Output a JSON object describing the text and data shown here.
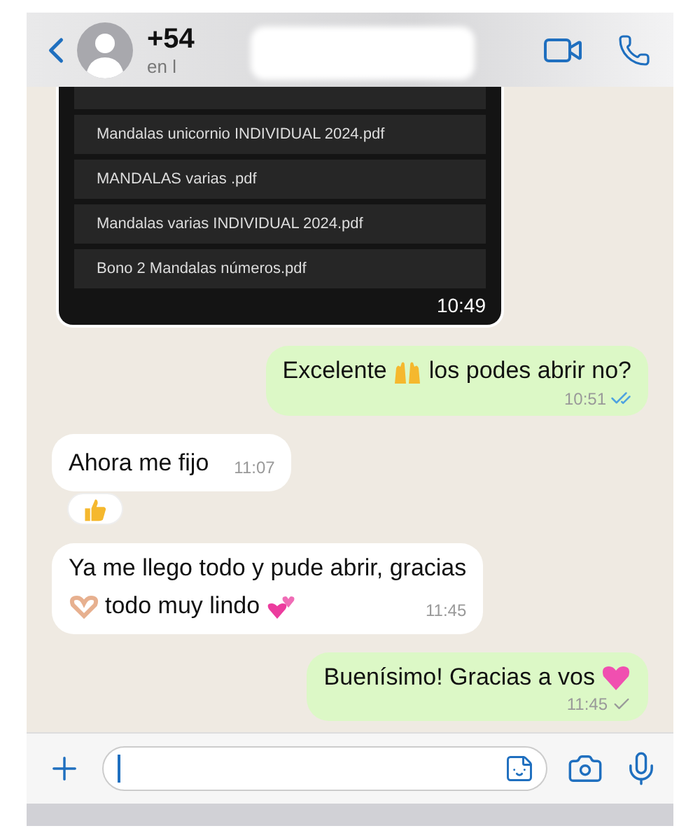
{
  "header": {
    "name": "+54",
    "status": "en l"
  },
  "files": {
    "items": [
      "Mandalas unicornio INDIVIDUAL 2024.pdf",
      "MANDALAS varias .pdf",
      "Mandalas varias INDIVIDUAL 2024.pdf",
      "Bono 2 Mandalas números.pdf"
    ],
    "time": "10:49"
  },
  "messages": [
    {
      "kind": "sent",
      "lines": [
        [
          {
            "kind": "text",
            "text": "Excelente"
          },
          {
            "kind": "raised-hands"
          },
          {
            "kind": "text",
            "text": "los podes abrir no?"
          }
        ]
      ],
      "time": "10:51",
      "read": true
    },
    {
      "kind": "received",
      "lines": [
        [
          {
            "kind": "text",
            "text": "Ahora me fijo"
          }
        ]
      ],
      "time": "11:07",
      "reaction": {
        "kind": "thumbs-up"
      }
    },
    {
      "kind": "received",
      "lines": [
        [
          {
            "kind": "text",
            "text": "Ya me llego todo y pude abrir, gracias"
          }
        ],
        [
          {
            "kind": "heart-hands"
          },
          {
            "kind": "text",
            "text": "todo muy lindo"
          },
          {
            "kind": "two-hearts"
          }
        ]
      ],
      "time": "11:45"
    },
    {
      "kind": "sent",
      "lines": [
        [
          {
            "kind": "text",
            "text": "Buenísimo! Gracias a vos"
          },
          {
            "kind": "pink-heart"
          }
        ]
      ],
      "time": "11:45",
      "read": false
    }
  ]
}
